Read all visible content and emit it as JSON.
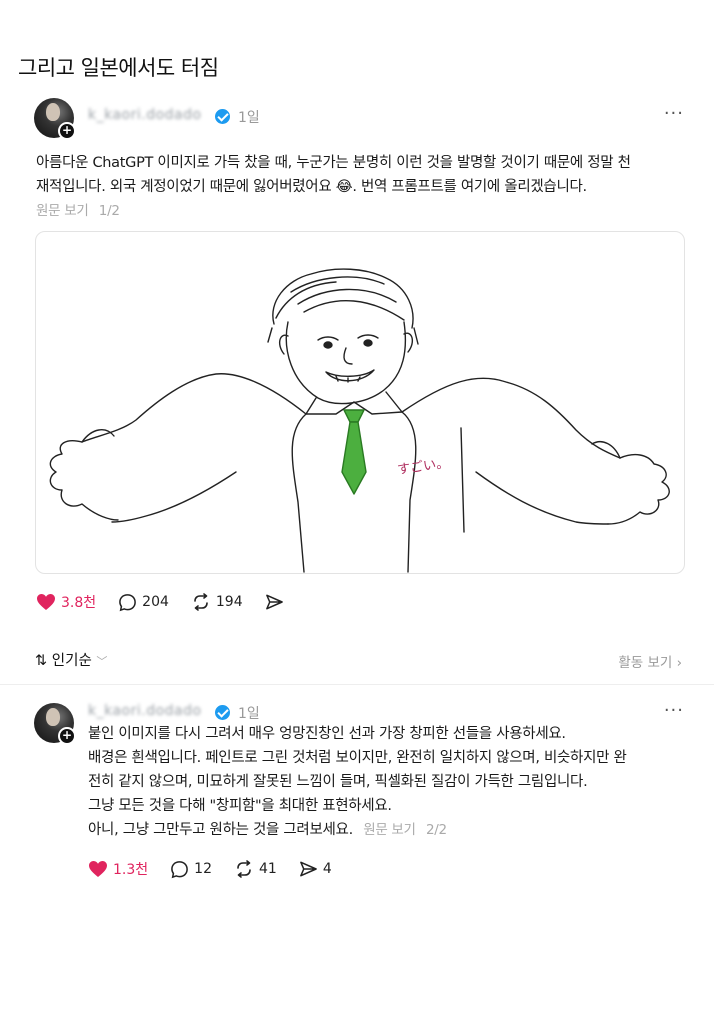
{
  "page_title": "그리고 일본에서도 터짐",
  "post1": {
    "username": "k_kaori.dodado",
    "time": "1일",
    "more": "···",
    "text_lines": [
      "아름다운 ChatGPT 이미지로 가득 찼을 때, 누군가는 분명히 이런 것을 발명할 것이기 때문에 정말 천",
      "재적입니다. 외국 계정이었기 때문에 잃어버렸어요 😂. 번역 프롬프트를 여기에 올리겠습니다."
    ],
    "see_original": "원문 보기",
    "page_indicator": "1/2",
    "image_caption": "すごい。",
    "likes": "3.8천",
    "comments": "204",
    "reposts": "194"
  },
  "sort": {
    "label": "인기순",
    "activity": "활동 보기"
  },
  "post2": {
    "username": "k_kaori.dodado",
    "time": "1일",
    "more": "···",
    "text_lines": [
      "붙인 이미지를 다시 그려서 매우 엉망진창인 선과 가장 창피한 선들을 사용하세요.",
      "배경은 흰색입니다. 페인트로 그린 것처럼 보이지만, 완전히 일치하지 않으며, 비슷하지만 완",
      "전히 같지 않으며, 미묘하게 잘못된 느낌이 들며, 픽셀화된 질감이 가득한 그림입니다.",
      "그냥 모든 것을 다해 \"창피함\"을 최대한 표현하세요.",
      "아니, 그냥 그만두고 원하는 것을 그려보세요."
    ],
    "see_original": "원문 보기",
    "page_indicator": "2/2",
    "likes": "1.3천",
    "comments": "12",
    "reposts": "41",
    "shares": "4"
  },
  "colors": {
    "like": "#e0245e",
    "verified": "#1d9bf0",
    "tie": "#4caf3f"
  }
}
